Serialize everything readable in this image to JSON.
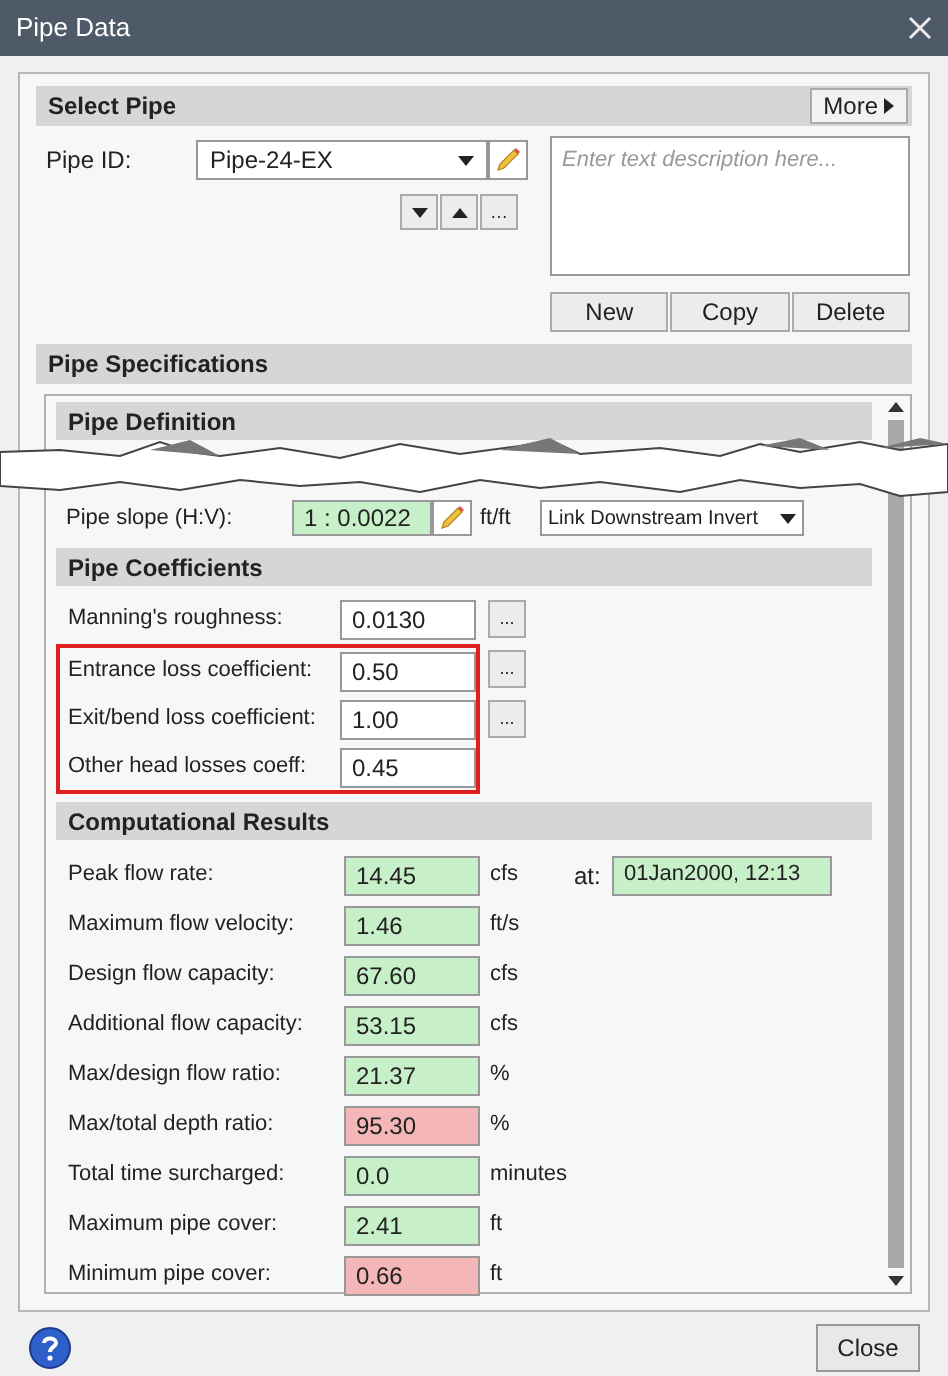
{
  "window": {
    "title": "Pipe Data"
  },
  "select_pipe": {
    "title": "Select Pipe",
    "more_button": "More",
    "pipe_id_label": "Pipe ID:",
    "pipe_id": "Pipe-24-EX",
    "nav_buttons": [
      "…"
    ],
    "description_placeholder": "Enter text description here...",
    "buttons": [
      "New",
      "Copy",
      "Delete"
    ]
  },
  "pipe_specifications": {
    "title": "Pipe Specifications",
    "pipe_definition": {
      "title": "Pipe Definition"
    },
    "pipe_slope": {
      "label": "Pipe slope (H:V):",
      "value": "1 : 0.0022",
      "unit": "ft/ft",
      "dropdown": "Link Downstream Invert"
    },
    "pipe_coefficients": {
      "title": "Pipe Coefficients",
      "rows": [
        {
          "label": "Manning's roughness:",
          "value": "0.0130",
          "browse": "...",
          "highlighted": false
        },
        {
          "label": "Entrance loss coefficient:",
          "value": "0.50",
          "browse": "...",
          "highlighted": true
        },
        {
          "label": "Exit/bend loss coefficient:",
          "value": "1.00",
          "browse": "...",
          "highlighted": true
        },
        {
          "label": "Other head losses coeff:",
          "value": "0.45",
          "highlighted": true
        }
      ]
    },
    "computational_results": {
      "title": "Computational Results",
      "rows": [
        {
          "label": "Peak flow rate:",
          "value": "14.45",
          "unit": "cfs",
          "color": "#c8f0c8",
          "at_label": "at:",
          "at_value": "01Jan2000, 12:13"
        },
        {
          "label": "Maximum flow velocity:",
          "value": "1.46",
          "unit": "ft/s",
          "color": "#c8f0c8"
        },
        {
          "label": "Design flow capacity:",
          "value": "67.60",
          "unit": "cfs",
          "color": "#c8f0c8"
        },
        {
          "label": "Additional flow capacity:",
          "value": "53.15",
          "unit": "cfs",
          "color": "#c8f0c8"
        },
        {
          "label": "Max/design flow ratio:",
          "value": "21.37",
          "unit": "%",
          "color": "#c8f0c8"
        },
        {
          "label": "Max/total depth ratio:",
          "value": "95.30",
          "unit": "%",
          "color": "#f4b6b6"
        },
        {
          "label": "Total time surcharged:",
          "value": "0.0",
          "unit": "minutes",
          "color": "#c8f0c8"
        },
        {
          "label": "Maximum pipe cover:",
          "value": "2.41",
          "unit": "ft",
          "color": "#c8f0c8"
        },
        {
          "label": "Minimum pipe cover:",
          "value": "0.66",
          "unit": "ft",
          "color": "#f4b6b6"
        }
      ]
    }
  },
  "footer": {
    "close_button": "Close"
  }
}
